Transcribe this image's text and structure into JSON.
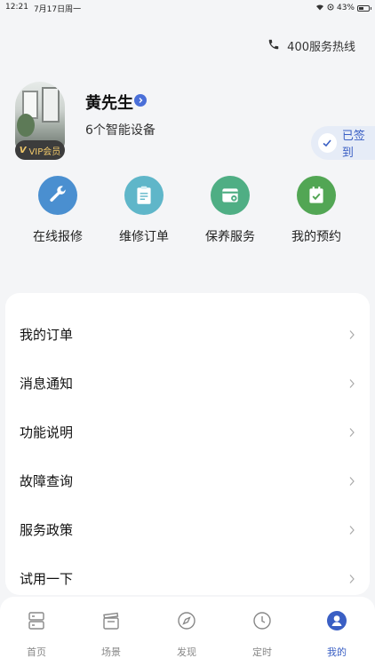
{
  "status_bar": {
    "time": "12:21",
    "date": "7月17日周一",
    "battery": "43%",
    "icons": [
      "wifi-icon",
      "location-icon",
      "battery-icon"
    ]
  },
  "hotline": {
    "label": "400服务热线",
    "icon": "phone-icon"
  },
  "profile": {
    "name": "黄先生",
    "device_count": "6个智能设备",
    "vip_label": "VIP会员",
    "vip_mark": "V",
    "checkin_label": "已签到"
  },
  "quick_actions": [
    {
      "label": "在线报修",
      "icon": "wrench-icon",
      "color": "#4a8fd0"
    },
    {
      "label": "维修订单",
      "icon": "clipboard-icon",
      "color": "#5fb6c9"
    },
    {
      "label": "保养服务",
      "icon": "service-card-icon",
      "color": "#4fae84"
    },
    {
      "label": "我的预约",
      "icon": "calendar-check-icon",
      "color": "#52a654"
    }
  ],
  "menu": [
    {
      "label": "我的订单"
    },
    {
      "label": "消息通知"
    },
    {
      "label": "功能说明"
    },
    {
      "label": "故障查询"
    },
    {
      "label": "服务政策"
    },
    {
      "label": "试用一下"
    }
  ],
  "tabs": [
    {
      "label": "首页",
      "icon": "home-devices-icon",
      "active": false
    },
    {
      "label": "场景",
      "icon": "clapperboard-icon",
      "active": false
    },
    {
      "label": "发现",
      "icon": "compass-icon",
      "active": false
    },
    {
      "label": "定时",
      "icon": "clock-icon",
      "active": false
    },
    {
      "label": "我的",
      "icon": "profile-icon",
      "active": true
    }
  ],
  "colors": {
    "accent": "#3a5fc4",
    "background": "#f4f5f7",
    "card": "#ffffff"
  }
}
